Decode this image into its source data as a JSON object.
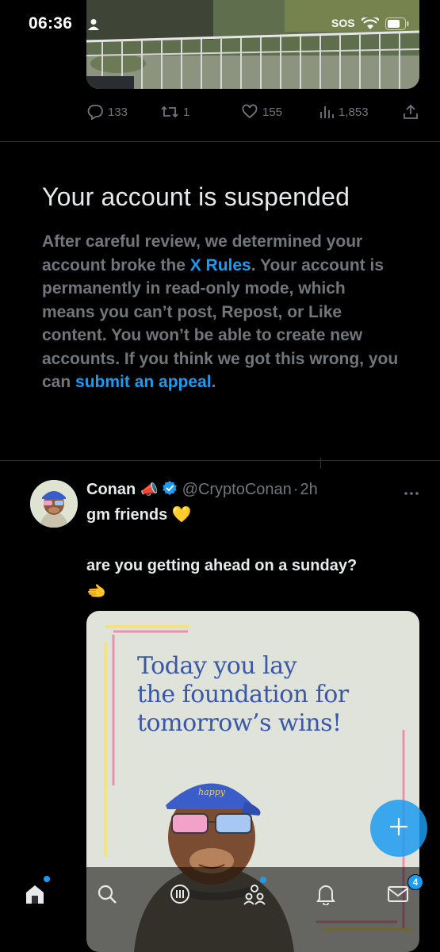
{
  "status_bar": {
    "time": "06:36",
    "sos": "SOS"
  },
  "tweet_actions": {
    "replies": "133",
    "reposts": "1",
    "likes": "155",
    "views": "1,853"
  },
  "suspension": {
    "title": "Your account is suspended",
    "body_1": "After careful review, we determined your account broke the ",
    "rules_link": "X Rules",
    "body_2": ". Your account is permanently in read-only mode, which means you can’t post, Repost, or Like content. You won’t be able to create new accounts. If you think we got this wrong, you can ",
    "appeal_link": "submit an appeal",
    "body_3": "."
  },
  "tweet": {
    "name": "Conan",
    "name_emoji": "📣",
    "handle": "@CryptoConan",
    "separator": "·",
    "age": "2h",
    "line1": "gm friends 💛",
    "line2": "are you getting ahead on a sunday?",
    "line3": "🫲",
    "card": {
      "line1": "Today you lay",
      "line2": "the foundation for",
      "line3": "tomorrow’s wins!",
      "cap_text": "happy"
    }
  },
  "nav": {
    "items": [
      "home",
      "search",
      "grok",
      "communities",
      "notifications",
      "messages"
    ],
    "messages_badge": "4"
  },
  "colors": {
    "background": "#000000",
    "text_primary": "#e7e9ea",
    "text_secondary": "#71767b",
    "accent": "#1d9bf0",
    "divider": "#2f3336",
    "card_bg": "#dfe3d9",
    "card_text": "#3b57a8"
  }
}
